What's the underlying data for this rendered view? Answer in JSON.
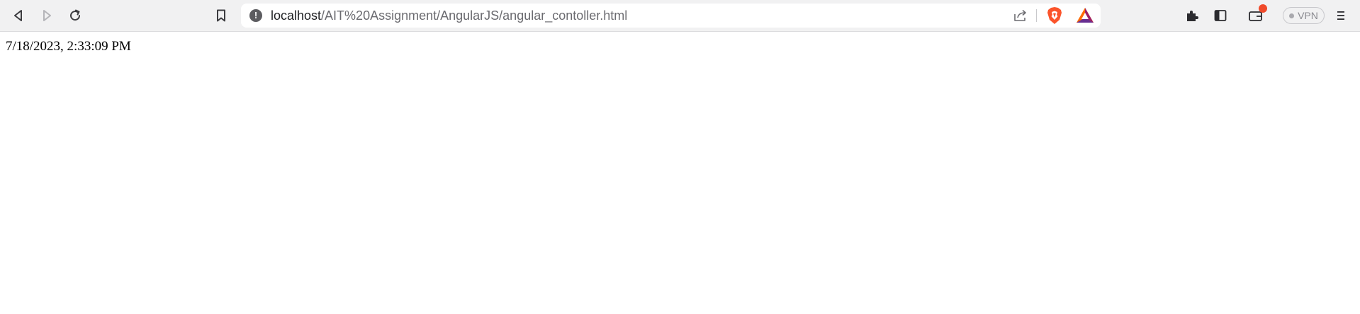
{
  "browser": {
    "url_host": "localhost",
    "url_path": "/AIT%20Assignment/AngularJS/angular_contoller.html",
    "vpn_label": "VPN",
    "info_glyph": "!",
    "icons": {
      "back": "back-arrow-icon",
      "forward": "forward-arrow-icon",
      "reload": "reload-icon",
      "bookmark": "bookmark-icon",
      "site_info": "site-info-icon",
      "share": "share-icon",
      "shields": "brave-shields-icon",
      "rewards": "brave-rewards-icon",
      "extensions": "extensions-icon",
      "sidebar": "sidebar-icon",
      "wallet": "wallet-icon",
      "menu": "menu-icon"
    },
    "colors": {
      "toolbar": "#f1f1f2",
      "shield": "#fb542b",
      "rewards_orange": "#ff6a00",
      "rewards_purple": "#662d91",
      "notification": "#f04a2b"
    }
  },
  "page": {
    "datetime_text": "7/18/2023, 2:33:09 PM"
  }
}
